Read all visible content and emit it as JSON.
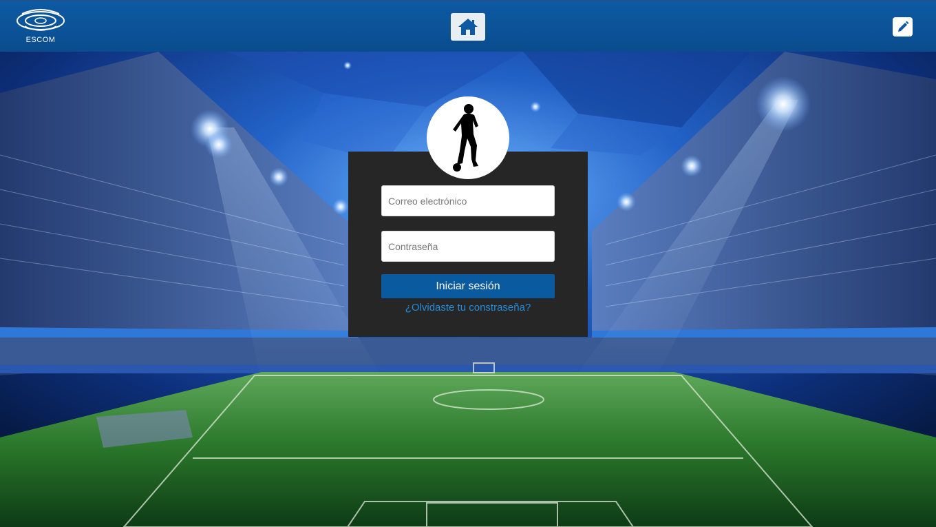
{
  "header": {
    "logo_text": "ESCOM",
    "home_icon": "home-icon",
    "edit_icon": "pencil-icon"
  },
  "login": {
    "email_placeholder": "Correo electrónico",
    "password_placeholder": "Contraseña",
    "submit_label": "Iniciar sesión",
    "forgot_label": "¿Olvidaste tu constraseña?",
    "avatar_icon": "soccer-player-icon"
  },
  "colors": {
    "header": "#0a4c8e",
    "card": "#262626",
    "button": "#0a5aa0",
    "link": "#1f8ee0"
  }
}
